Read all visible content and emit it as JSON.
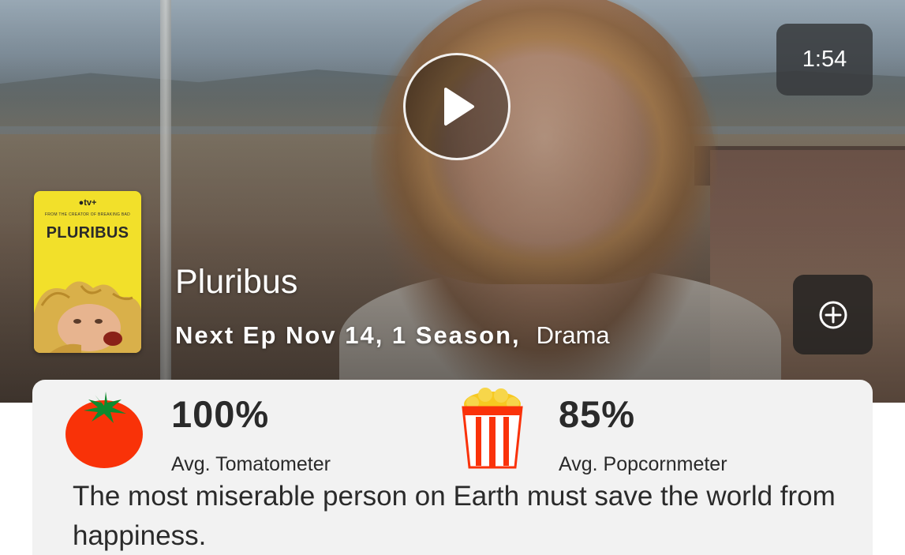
{
  "video": {
    "duration": "1:54",
    "play_icon": "play-icon",
    "add_icon": "plus-circle-icon"
  },
  "poster": {
    "brand": "tv+",
    "tagline": "FROM THE CREATOR OF BREAKING BAD",
    "title": "PLURIBUS",
    "background_color": "#f2e02a"
  },
  "show": {
    "title": "Pluribus",
    "next_ep": "Next Ep Nov 14, 1 Season,",
    "genre": "Drama"
  },
  "scores": {
    "tomatometer": {
      "value": "100%",
      "label": "Avg. Tomatometer",
      "icon": "tomato-icon",
      "color": "#f93208"
    },
    "popcornmeter": {
      "value": "85%",
      "label": "Avg. Popcornmeter",
      "icon": "popcorn-icon",
      "color": "#fa320a"
    }
  },
  "synopsis": "The most miserable person on Earth must save the world from happiness."
}
